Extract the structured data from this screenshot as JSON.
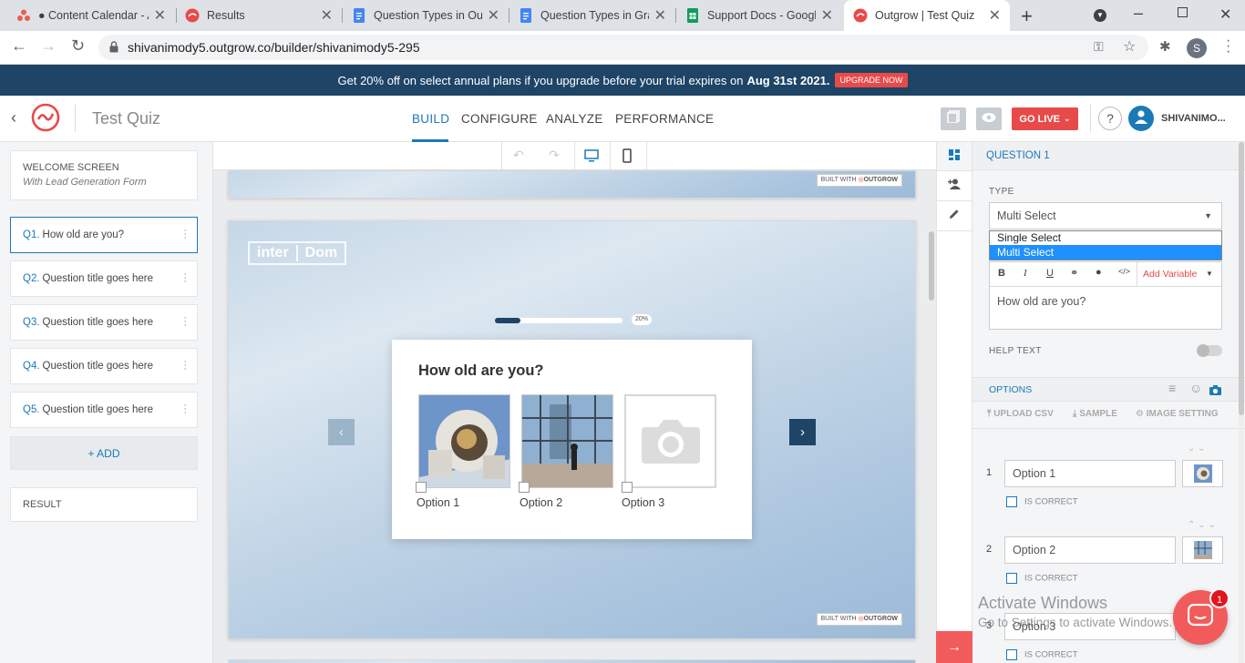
{
  "browser": {
    "tabs": [
      {
        "title": "● Content Calendar - A",
        "color": "#e84a4a"
      },
      {
        "title": "Results",
        "color": "#e84a4a"
      },
      {
        "title": "Question Types in Out",
        "color": "#4285f4"
      },
      {
        "title": "Question Types in Gra",
        "color": "#4285f4"
      },
      {
        "title": "Support Docs - Googl",
        "color": "#0f9d58"
      },
      {
        "title": "Outgrow | Test Quiz",
        "color": "#e84a4a"
      }
    ],
    "url": "shivanimody5.outgrow.co/builder/shivanimody5-295",
    "profile_initial": "S"
  },
  "promo": {
    "text": "Get 20% off on select annual plans if you upgrade before your trial expires on",
    "date": "Aug 31st 2021.",
    "button": "UPGRADE NOW"
  },
  "header": {
    "title": "Test Quiz",
    "nav": [
      "BUILD",
      "CONFIGURE",
      "ANALYZE",
      "PERFORMANCE"
    ],
    "go_live": "GO LIVE",
    "help": "?",
    "user": "SHIVANIMO..."
  },
  "left": {
    "welcome_title": "WELCOME SCREEN",
    "welcome_sub": "With Lead Generation Form",
    "questions": [
      {
        "num": "Q1.",
        "title": "How old are you?"
      },
      {
        "num": "Q2.",
        "title": "Question title goes here"
      },
      {
        "num": "Q3.",
        "title": "Question title goes here"
      },
      {
        "num": "Q4.",
        "title": "Question title goes here"
      },
      {
        "num": "Q5.",
        "title": "Question title goes here"
      }
    ],
    "add": "+ ADD",
    "result": "RESULT"
  },
  "canvas": {
    "built_with": "BUILT WITH",
    "brand": "OUTGROW",
    "logo_a": "inter",
    "logo_b": "Dom",
    "progress_label": "20%",
    "progress": 0.2,
    "question": "How old are you?",
    "options": [
      "Option 1",
      "Option 2",
      "Option 3"
    ]
  },
  "panel": {
    "section": "QUESTION 1",
    "type_label": "TYPE",
    "type_value": "Multi Select",
    "dropdown": [
      "Single Select",
      "Multi Select"
    ],
    "add_variable": "Add Variable",
    "question_text": "How old are you?",
    "help_text": "HELP TEXT",
    "options_label": "OPTIONS",
    "upload_csv": "UPLOAD CSV",
    "sample": "SAMPLE",
    "image_setting": "IMAGE SETTING",
    "is_correct": "IS CORRECT",
    "options": [
      {
        "n": "1",
        "value": "Option 1"
      },
      {
        "n": "2",
        "value": "Option 2"
      },
      {
        "n": "3",
        "value": "Option 3"
      }
    ]
  },
  "overlay": {
    "activate_title": "Activate Windows",
    "activate_sub": "Go to Settings to activate Windows.",
    "chat_badge": "1"
  }
}
